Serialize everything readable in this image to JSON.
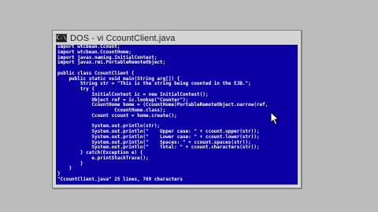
{
  "window": {
    "title": "DOS - vi CcountClient.java",
    "system_menu_glyph": "C:\\"
  },
  "editor": {
    "lines": [
      "import wtcbean.Ccount;",
      "import wtcbean.CcountHome;",
      "import javax.naming.InitialContext;",
      "import javax.rmi.PortableRemoteObject;",
      "",
      "public class CcountClient {",
      "    public static void main(String arg[]) {",
      "        String str = \"This is the string being counted in the EJB.\";",
      "        try {",
      "            InitialContext ic = new InitialContext();",
      "            Object ref = ic.lookup(\"Counter\");",
      "            CcountHome home = (CcountHome)PortableRemoteObject.narrow(ref,",
      "                    CcountHome.class);",
      "            Ccount ccount = home.create();",
      "",
      "            System.out.println(str);",
      "            System.out.println(\"    Upper case: \" + ccount.upper(str));",
      "            System.out.println(\"    Lower case: \" + ccount.lower(str));",
      "            System.out.println(\"    Spaces: \" + ccount.spaces(str));",
      "            System.out.println(\"    Total: \" + ccount.characters(str));",
      "        } catch(Exception e) {",
      "            e.printStackTrace();",
      "        }",
      "    }",
      "}"
    ],
    "status": "\"CcountClient.java\" 25 lines, 769 characters"
  },
  "colors": {
    "console_bg": "#0a00a4",
    "console_fg": "#ffffff",
    "desktop_bg": "#bcbcbc"
  }
}
